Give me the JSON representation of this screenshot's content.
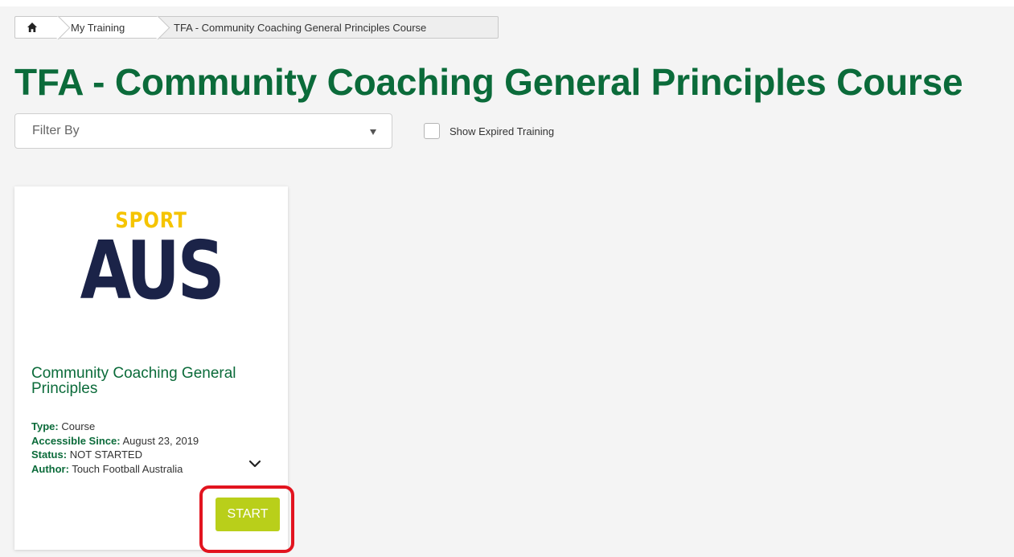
{
  "breadcrumb": {
    "home_icon": "home-icon",
    "items": [
      "My Training",
      "TFA - Community Coaching General Principles Course"
    ]
  },
  "page": {
    "title": "TFA - Community Coaching General Principles Course"
  },
  "filter": {
    "placeholder": "Filter By",
    "show_expired_label": "Show Expired Training",
    "show_expired_checked": false
  },
  "card": {
    "logo": {
      "line1": "SPORT",
      "line2": "AUS"
    },
    "title": "Community Coaching General Principles",
    "type_label": "Type:",
    "type_value": "Course",
    "since_label": "Accessible Since:",
    "since_value": "August 23, 2019",
    "status_label": "Status:",
    "status_value": "NOT STARTED",
    "author_label": "Author:",
    "author_value": "Touch Football Australia",
    "start_label": "START"
  },
  "colors": {
    "brand_green": "#0b6b3a",
    "start_button": "#b9cf1a",
    "highlight": "#e2141f",
    "logo_yellow": "#f5c400",
    "logo_navy": "#1b2348"
  }
}
